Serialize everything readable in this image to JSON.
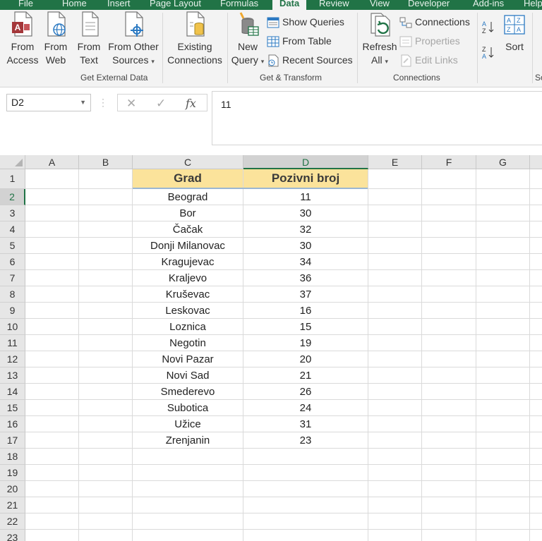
{
  "tabs": [
    "File",
    "Home",
    "Insert",
    "Page Layout",
    "Formulas",
    "Data",
    "Review",
    "View",
    "Developer",
    "Add-ins",
    "Help"
  ],
  "active_tab": "Data",
  "ribbon": {
    "get_external_data": {
      "label": "Get External Data",
      "buttons": [
        {
          "line1": "From",
          "line2": "Access",
          "icon": "access-db-icon"
        },
        {
          "line1": "From",
          "line2": "Web",
          "icon": "web-globe-icon"
        },
        {
          "line1": "From",
          "line2": "Text",
          "icon": "text-file-icon"
        },
        {
          "line1": "From Other",
          "line2": "Sources",
          "icon": "other-sources-icon"
        },
        {
          "line1": "Existing",
          "line2": "Connections",
          "icon": "existing-connections-icon"
        }
      ]
    },
    "get_transform": {
      "label": "Get & Transform",
      "new_query": {
        "line1": "New",
        "line2": "Query"
      },
      "show_queries": "Show Queries",
      "from_table": "From Table",
      "recent_sources": "Recent Sources"
    },
    "connections": {
      "label": "Connections",
      "refresh": {
        "line1": "Refresh",
        "line2": "All"
      },
      "connections": "Connections",
      "properties": "Properties",
      "edit_links": "Edit Links"
    },
    "sort_filter": {
      "label": "Sort & Filter",
      "sort": "Sort"
    }
  },
  "formula_bar": {
    "name_box": "D2",
    "cancel": "✕",
    "enter": "✓",
    "fx": "fx",
    "value": "11"
  },
  "sheet": {
    "columns": [
      "A",
      "B",
      "C",
      "D",
      "E",
      "F",
      "G"
    ],
    "selected_column": "D",
    "selected_row": "2",
    "rows": [
      "1",
      "2",
      "3",
      "4",
      "5",
      "6",
      "7",
      "8",
      "9",
      "10",
      "11",
      "12",
      "13",
      "14",
      "15",
      "16",
      "17",
      "18",
      "19",
      "20",
      "21",
      "22",
      "23"
    ],
    "table_headers": {
      "grad": "Grad",
      "pozivni": "Pozivni broj"
    },
    "table": [
      {
        "grad": "Beograd",
        "broj": "11"
      },
      {
        "grad": "Bor",
        "broj": "30"
      },
      {
        "grad": "Čačak",
        "broj": "32"
      },
      {
        "grad": "Donji Milanovac",
        "broj": "30"
      },
      {
        "grad": "Kragujevac",
        "broj": "34"
      },
      {
        "grad": "Kraljevo",
        "broj": "36"
      },
      {
        "grad": "Kruševac",
        "broj": "37"
      },
      {
        "grad": "Leskovac",
        "broj": "16"
      },
      {
        "grad": "Loznica",
        "broj": "15"
      },
      {
        "grad": "Negotin",
        "broj": "19"
      },
      {
        "grad": "Novi Pazar",
        "broj": "20"
      },
      {
        "grad": "Novi Sad",
        "broj": "21"
      },
      {
        "grad": "Smederevo",
        "broj": "26"
      },
      {
        "grad": "Subotica",
        "broj": "24"
      },
      {
        "grad": "Užice",
        "broj": "31"
      },
      {
        "grad": "Zrenjanin",
        "broj": "23"
      }
    ]
  },
  "colors": {
    "ribbon_green": "#217346",
    "header_fill": "#fbe39b",
    "header_border": "#9bb7d2"
  }
}
